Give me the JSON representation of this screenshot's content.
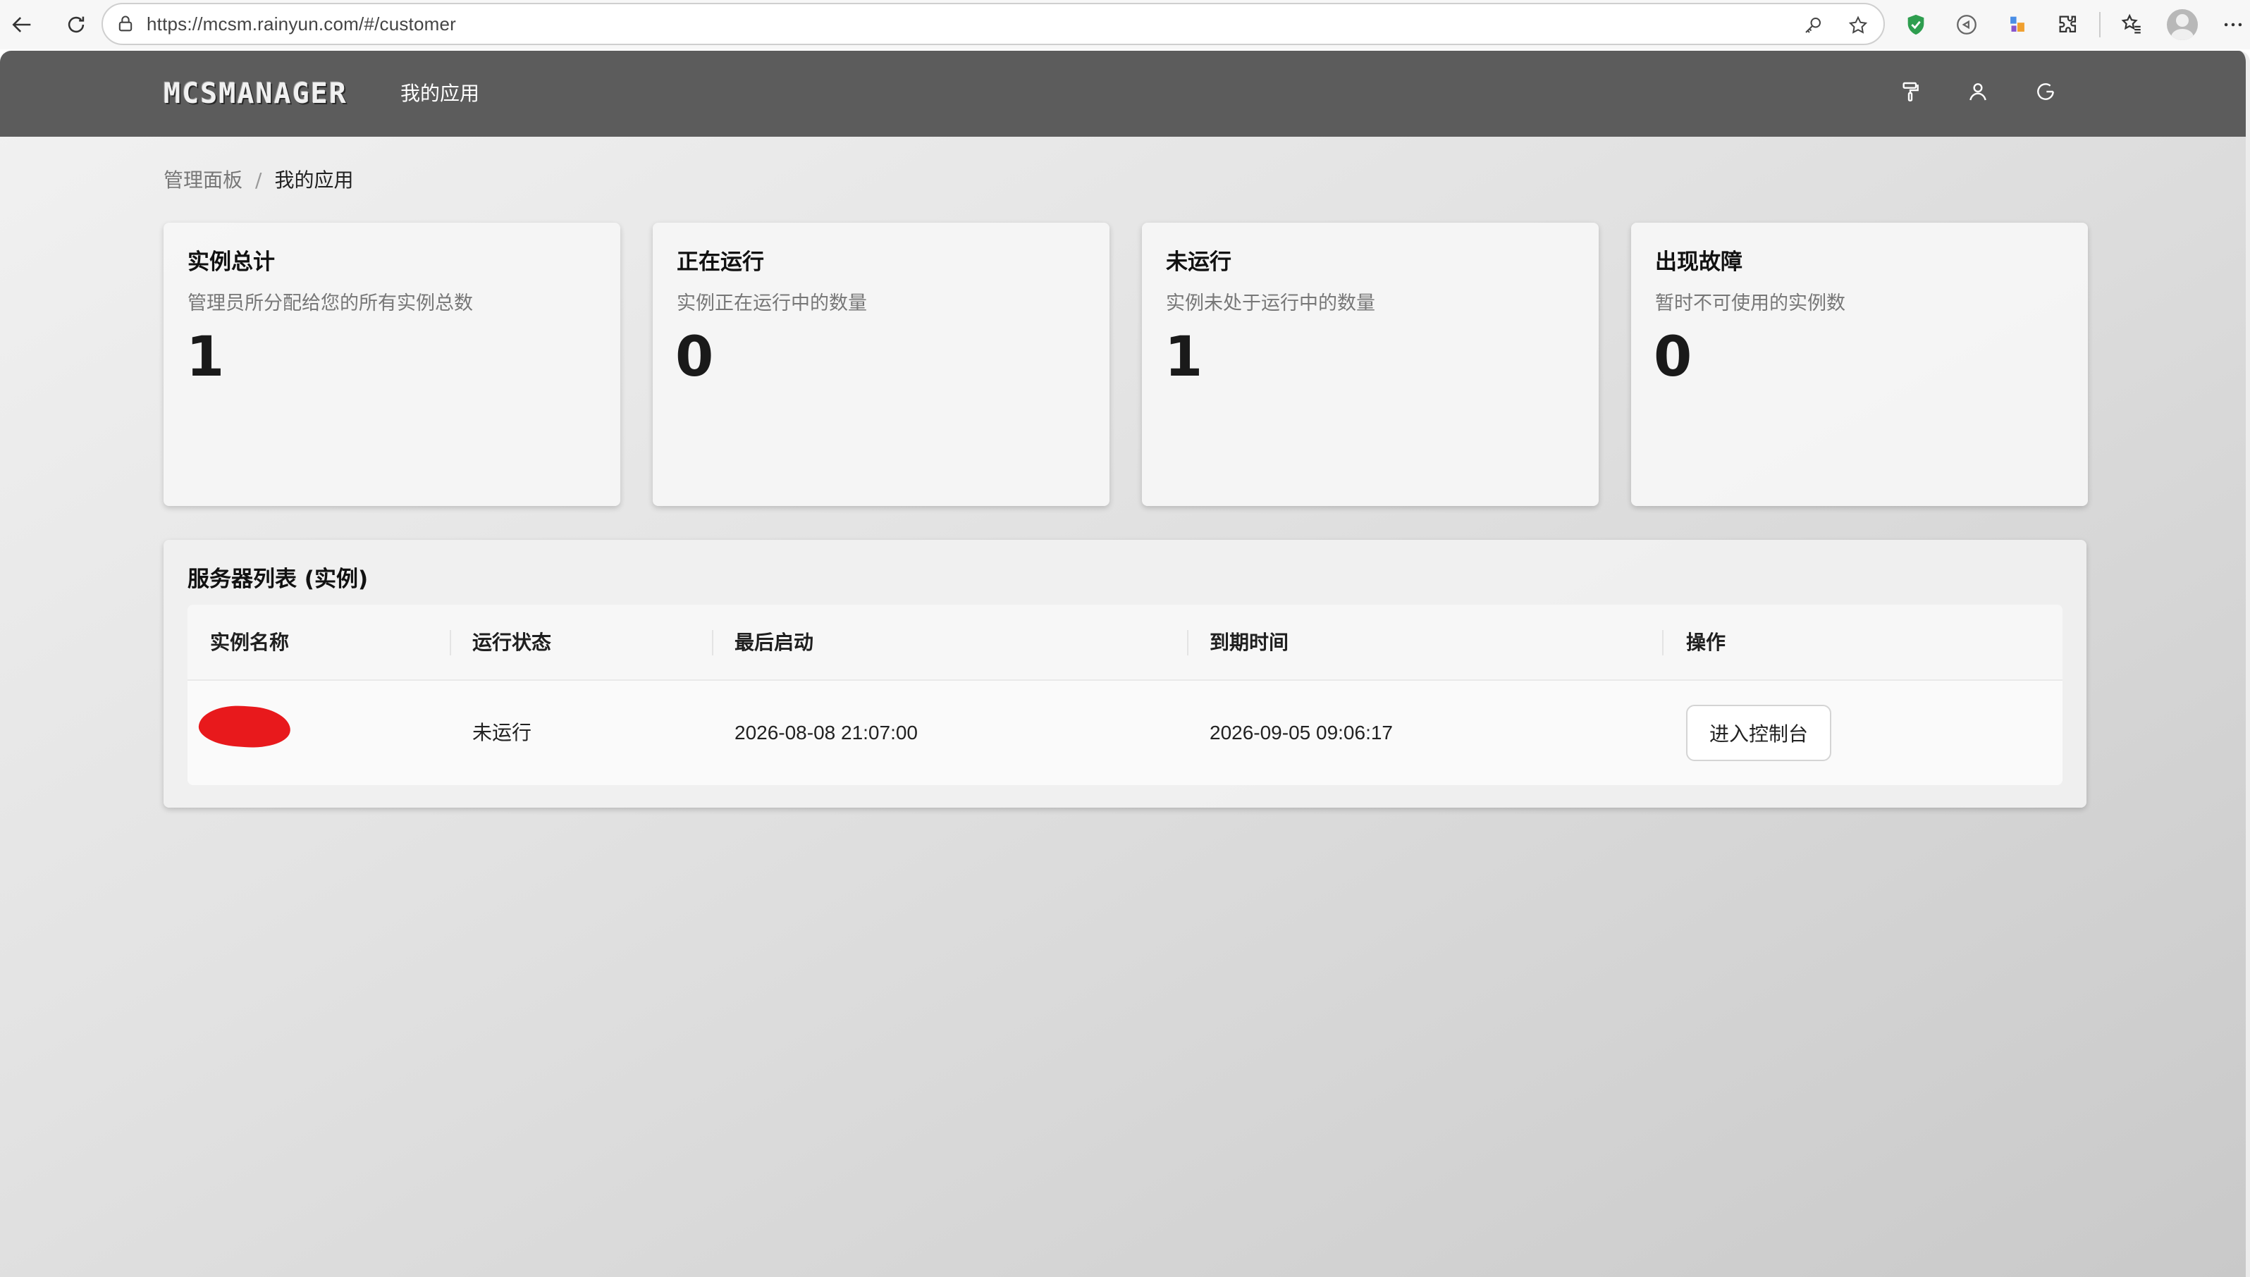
{
  "browser": {
    "url": "https://mcsm.rainyun.com/#/customer"
  },
  "header": {
    "logo_text": "MCSMANAGER",
    "nav_label": "我的应用"
  },
  "breadcrumb": {
    "root": "管理面板",
    "separator": "/",
    "current": "我的应用"
  },
  "stats": [
    {
      "title": "实例总计",
      "desc": "管理员所分配给您的所有实例总数",
      "value": "1"
    },
    {
      "title": "正在运行",
      "desc": "实例正在运行中的数量",
      "value": "0"
    },
    {
      "title": "未运行",
      "desc": "实例未处于运行中的数量",
      "value": "1"
    },
    {
      "title": "出现故障",
      "desc": "暂时不可使用的实例数",
      "value": "0"
    }
  ],
  "server_list": {
    "title": "服务器列表 (实例)",
    "columns": [
      "实例名称",
      "运行状态",
      "最后启动",
      "到期时间",
      "操作"
    ],
    "rows": [
      {
        "status": "未运行",
        "last_start": "2026-08-08 21:07:00",
        "expire": "2026-09-05 09:06:17",
        "action_label": "进入控制台"
      }
    ]
  },
  "colors": {
    "header_bg": "#5c5c5c",
    "redaction": "#e8191c"
  }
}
